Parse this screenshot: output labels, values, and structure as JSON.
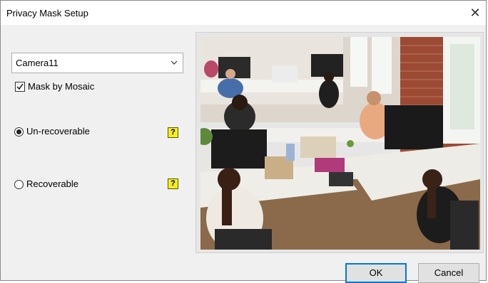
{
  "dialog": {
    "title": "Privacy Mask Setup"
  },
  "camera_select": {
    "selected": "Camera11"
  },
  "mask_by_mosaic": {
    "label": "Mask by Mosaic",
    "checked": true
  },
  "options": {
    "unrecoverable": {
      "label": "Un-recoverable",
      "selected": true,
      "help": "?"
    },
    "recoverable": {
      "label": "Recoverable",
      "selected": false,
      "help": "?"
    }
  },
  "buttons": {
    "ok": "OK",
    "cancel": "Cancel"
  },
  "icons": {
    "close": "close-icon",
    "dropdown": "chevron-down-icon",
    "help": "help-icon"
  },
  "colors": {
    "help_bg": "#f4ee1c",
    "ok_border": "#0078d7"
  }
}
